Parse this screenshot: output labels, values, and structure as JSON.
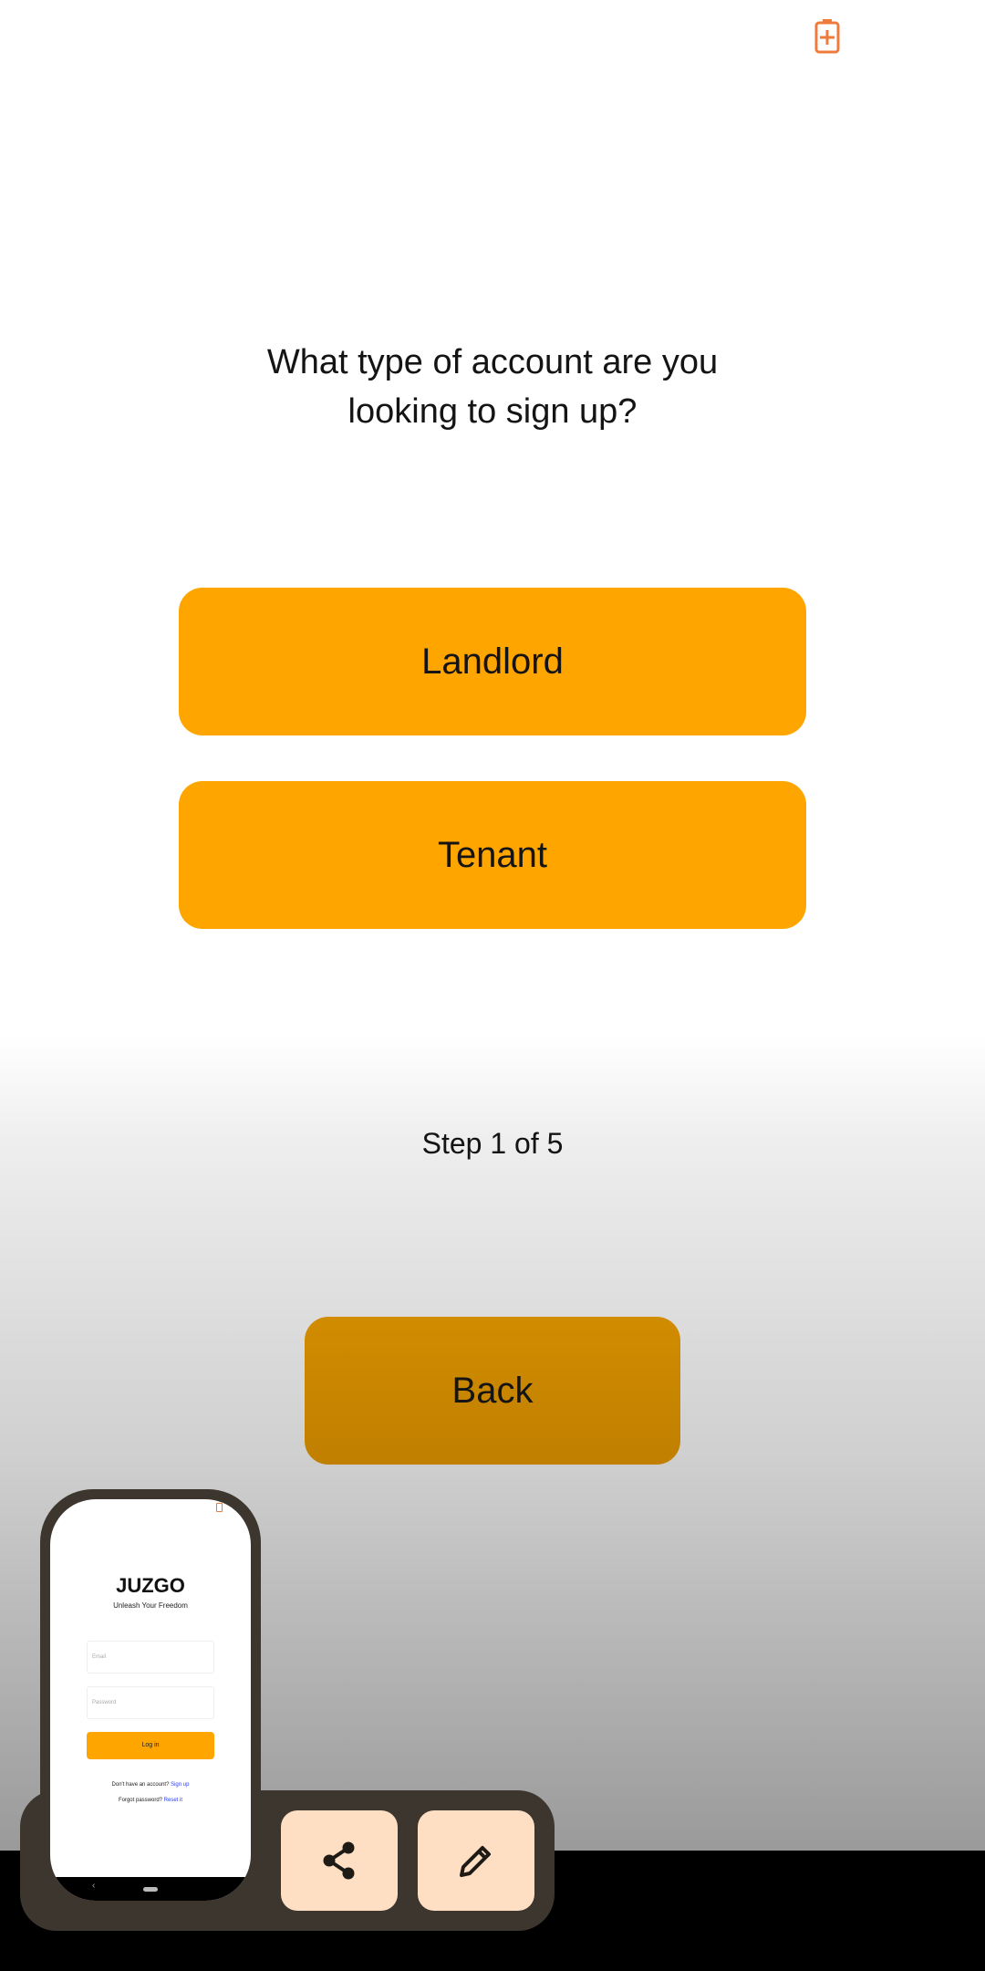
{
  "status_bar": {
    "battery_icon": "battery-charging-icon",
    "battery_color": "#f07a3c"
  },
  "question": "What type of account are you looking to sign up?",
  "options": [
    {
      "label": "Landlord"
    },
    {
      "label": "Tenant"
    }
  ],
  "step_text": "Step 1 of 5",
  "back_label": "Back",
  "colors": {
    "accent": "#ffa500",
    "back_button": "#cc8800",
    "tray": "#3c362f",
    "action_button": "#ffdfc3"
  },
  "preview": {
    "app_title": "JUZGO",
    "tagline": "Unleash Your Freedom",
    "email_placeholder": "Email",
    "password_placeholder": "Password",
    "login_label": "Log in",
    "no_account_text": "Don't have an account?",
    "signup_link": "Sign up",
    "forgot_text": "Forgot password?",
    "reset_link": "Reset it"
  },
  "actions": [
    {
      "name": "share",
      "icon": "share-icon"
    },
    {
      "name": "edit",
      "icon": "pencil-icon"
    }
  ]
}
